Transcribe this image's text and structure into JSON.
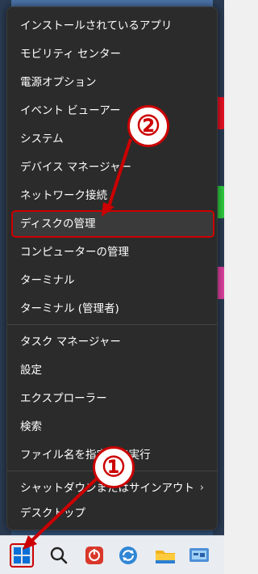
{
  "menu": {
    "items": [
      {
        "label": "インストールされているアプリ"
      },
      {
        "label": "モビリティ センター"
      },
      {
        "label": "電源オプション"
      },
      {
        "label": "イベント ビューアー"
      },
      {
        "label": "システム"
      },
      {
        "label": "デバイス マネージャー"
      },
      {
        "label": "ネットワーク接続"
      },
      {
        "label": "ディスクの管理"
      },
      {
        "label": "コンピューターの管理"
      },
      {
        "label": "ターミナル"
      },
      {
        "label": "ターミナル (管理者)"
      },
      {
        "label": "タスク マネージャー"
      },
      {
        "label": "設定"
      },
      {
        "label": "エクスプローラー"
      },
      {
        "label": "検索"
      },
      {
        "label": "ファイル名を指定して実行"
      },
      {
        "label": "シャットダウンまたはサインアウト"
      },
      {
        "label": "デスクトップ"
      }
    ],
    "submenu_indicator": "›"
  },
  "annotations": {
    "step1": "①",
    "step2": "②",
    "color": "#cc0000"
  },
  "taskbar": {
    "icons": [
      "windows-start-icon",
      "search-icon",
      "power-app-icon",
      "sync-icon",
      "file-explorer-icon",
      "control-panel-icon"
    ]
  },
  "colors": {
    "menu_bg": "#2b2b2b",
    "highlight": "#cc0000",
    "taskbar_bg": "#e9ecf0"
  }
}
